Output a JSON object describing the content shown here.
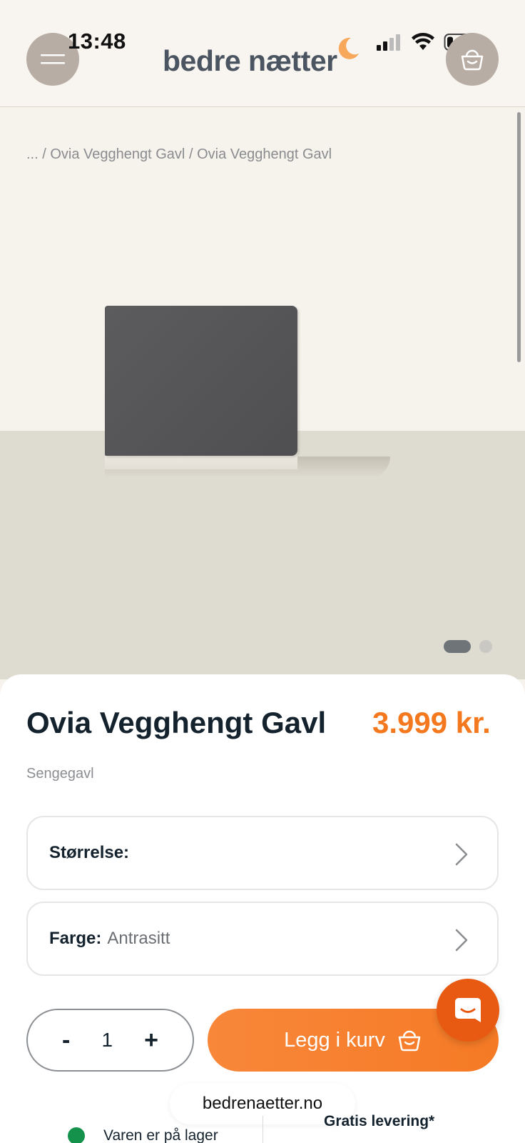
{
  "status_bar": {
    "time": "13:48"
  },
  "header": {
    "logo": "bedre nætter",
    "menu_icon": "hamburger-icon",
    "cart_icon": "basket-icon"
  },
  "breadcrumb": {
    "ellipsis": "...",
    "items": [
      "Ovia Vegghengt Gavl",
      "Ovia Vegghengt Gavl"
    ]
  },
  "gallery": {
    "slide_count": 2,
    "active_index": 0
  },
  "product": {
    "title": "Ovia Vegghengt Gavl",
    "price": "3.999 kr.",
    "category": "Sengegavl"
  },
  "options": {
    "size_label": "Størrelse:",
    "size_value": "",
    "color_label": "Farge:",
    "color_value": "Antrasitt"
  },
  "quantity": {
    "minus": "-",
    "value": "1",
    "plus": "+"
  },
  "add_to_cart": {
    "label": "Legg i kurv"
  },
  "browser": {
    "url": "bedrenaetter.no"
  },
  "info": {
    "stock_text": "Varen er på lager",
    "stock_color": "#14914b",
    "shipping_text": "Gratis levering*"
  },
  "colors": {
    "accent": "#f57a25",
    "chat": "#e85a11",
    "text_dark": "#14222e"
  }
}
